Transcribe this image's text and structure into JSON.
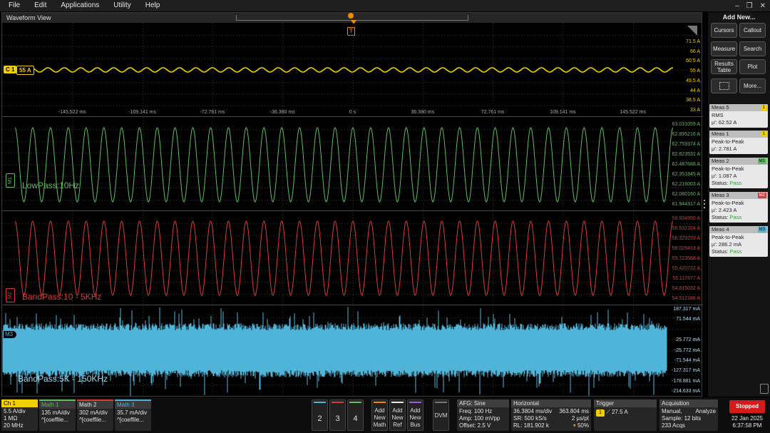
{
  "menu": [
    "File",
    "Edit",
    "Applications",
    "Utility",
    "Help"
  ],
  "window_controls": [
    "–",
    "❐",
    "✕"
  ],
  "waveform_view": {
    "title": "Waveform View",
    "trigger_marker": "T",
    "c1_badge": "C 1",
    "c1_level": "55 A",
    "time_ticks": [
      "-145.522 ms",
      "-109.141 ms",
      "-72.761 ms",
      "-36.380 ms",
      "0 s",
      "36.380 ms",
      "72.761 ms",
      "109.141 ms",
      "145.522 ms"
    ],
    "c1_scale": [
      "71.5 A",
      "66 A",
      "60.5 A",
      "55 A",
      "49.5 A",
      "44 A",
      "38.5 A",
      "33 A"
    ],
    "m1_scale": [
      "63.031059 A",
      "62.895216 A",
      "62.759374 A",
      "62.623531 A",
      "62.487688 A",
      "62.351845 A",
      "62.216003 A",
      "62.080160 A",
      "61.944317 A"
    ],
    "m2_scale": [
      "56.934950 A",
      "56.632104 A",
      "56.329259 A",
      "56.026413 A",
      "55.723568 A",
      "55.420722 A",
      "55.117877 A",
      "54.815032 A",
      "54.512186 A"
    ],
    "m3_scale": [
      "187.317 mA",
      "71.544 mA",
      "",
      "25.772 mA",
      "-25.772 mA",
      "-71.544 mA",
      "-127.317 mA",
      "-178.881 mA",
      "-214.633 mA"
    ],
    "m1_tag": "M1",
    "m2_tag": "M2",
    "m3_tag": "M3",
    "m1_label": "LowPass:10Hz",
    "m2_label": "BandPass:10 - 5KHz",
    "m3_label": "BandPass:5K - 150KHz"
  },
  "right_panel": {
    "title": "Add New...",
    "buttons": {
      "cursors": "Cursors",
      "callout": "Callout",
      "measure": "Measure",
      "search": "Search",
      "results_table_1": "Results",
      "results_table_2": "Table",
      "plot": "Plot",
      "more": "More..."
    },
    "measurements": [
      {
        "name": "Meas 5",
        "tag": "1",
        "type": "RMS",
        "value": "µ': 62.52 A",
        "status": ""
      },
      {
        "name": "Meas 1",
        "tag": "1",
        "type": "Peak-to-Peak",
        "value": "µ': 2.781 A",
        "status": ""
      },
      {
        "name": "Meas 2",
        "tag": "M1",
        "type": "Peak-to-Peak",
        "value": "µ': 1.087 A",
        "status_label": "Status:",
        "status": "Pass"
      },
      {
        "name": "Meas 3",
        "tag": "M2",
        "type": "Peak-to-Peak",
        "value": "µ': 2.423 A",
        "status_label": "Status:",
        "status": "Pass"
      },
      {
        "name": "Meas 4",
        "tag": "M3",
        "type": "Peak-to-Peak",
        "value": "µ': 286.2 mA",
        "status_label": "Status:",
        "status": "Pass"
      }
    ]
  },
  "bottom_bar": {
    "ch1": {
      "title": "Ch 1",
      "l1": "5.5 A/div",
      "l2": "1 MΩ",
      "l3": "20 MHz",
      "bw_icon": "Bw"
    },
    "math1": {
      "title": "Math 1",
      "l1": "135 mA/div",
      "l2": "^[coeffile..."
    },
    "math2": {
      "title": "Math 2",
      "l1": "302 mA/div",
      "l2": "^[coeffile..."
    },
    "math3": {
      "title": "Math 3",
      "l1": "35.7 mA/div",
      "l2": "^[coeffile..."
    },
    "channel_buttons": [
      "2",
      "3",
      "4"
    ],
    "add_math": [
      "Add",
      "New",
      "Math"
    ],
    "add_ref": [
      "Add",
      "New",
      "Ref"
    ],
    "add_bus": [
      "Add",
      "New",
      "Bus"
    ],
    "dvm": "DVM",
    "afg": {
      "title": "AFG: Sine",
      "l1": "Freq: 100 Hz",
      "l2": "Amp: 100 mVpp",
      "l3": "Offset: 2.5 V"
    },
    "horizontal": {
      "title": "Horizontal",
      "l1a": "36.3804 ms/div",
      "l1b": "363.804 ms",
      "l2a": "SR: 500 kS/s",
      "l2b": "2 µs/pt",
      "l3a": "RL: 181.902 k",
      "l3b": "50%"
    },
    "trigger": {
      "title": "Trigger",
      "ch": "1",
      "level": "27.5 A"
    },
    "acquisition": {
      "title": "Acquisition",
      "l1a": "Manual,",
      "l1b": "Analyze",
      "l2": "Sample: 12 bits",
      "l3": "233 Acqs"
    },
    "status": "Stopped",
    "date": "22 Jan 2025",
    "time": "6:37:58 PM"
  },
  "colors": {
    "c1": "#f0d000",
    "m1": "#5fbe5f",
    "m2": "#d83b3b",
    "m3": "#4fb4d8"
  }
}
